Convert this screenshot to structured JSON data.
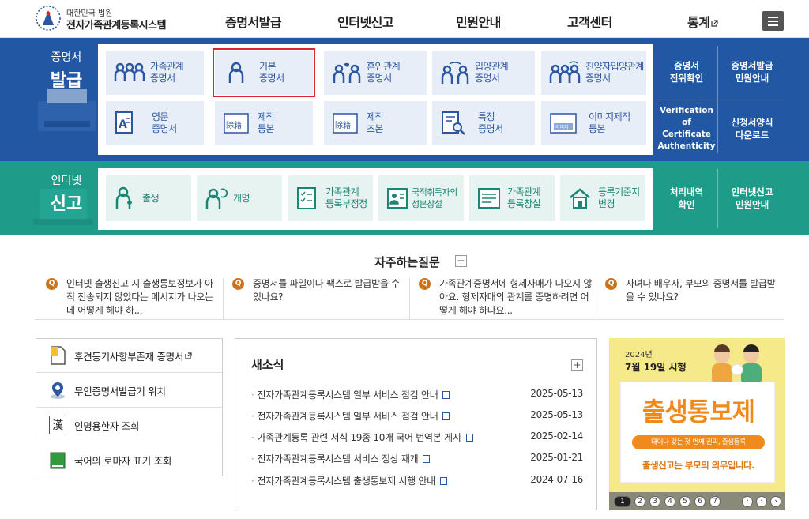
{
  "header": {
    "org": "대한민국 법원",
    "system": "전자가족관계등록시스템",
    "nav": [
      "증명서발급",
      "인터넷신고",
      "민원안내",
      "고객센터",
      "통계"
    ]
  },
  "cert": {
    "band_small": "증명서",
    "band_big": "발급",
    "cards": [
      {
        "l1": "가족관계",
        "l2": "증명서"
      },
      {
        "l1": "기본",
        "l2": "증명서"
      },
      {
        "l1": "혼인관계",
        "l2": "증명서"
      },
      {
        "l1": "입양관계",
        "l2": "증명서"
      },
      {
        "l1": "친양자입양관계",
        "l2": "증명서"
      },
      {
        "l1": "영문",
        "l2": "증명서"
      },
      {
        "l1": "제적",
        "l2": "등본"
      },
      {
        "l1": "제적",
        "l2": "초본"
      },
      {
        "l1": "특정",
        "l2": "증명서"
      },
      {
        "l1": "이미지제적",
        "l2": "등본"
      }
    ],
    "side": [
      {
        "l1": "증명서",
        "l2": "진위확인"
      },
      {
        "l1": "증명서발급",
        "l2": "민원안내"
      },
      {
        "l1": "Verification of",
        "l2": "Certificate",
        "l3": "Authenticity"
      },
      {
        "l1": "신청서양식",
        "l2": "다운로드"
      }
    ],
    "icon_texts": {
      "jejeok": "除籍",
      "image": "이미지"
    }
  },
  "report": {
    "band_small": "인터넷",
    "band_big": "신고",
    "cards": [
      {
        "l1": "출생",
        "l2": ""
      },
      {
        "l1": "개명",
        "l2": ""
      },
      {
        "l1": "가족관계",
        "l2": "등록부정정"
      },
      {
        "l1": "국적취득자의",
        "l2": "성본창설"
      },
      {
        "l1": "가족관계",
        "l2": "등록창설"
      },
      {
        "l1": "등록기준지",
        "l2": "변경"
      }
    ],
    "side": [
      {
        "l1": "처리내역",
        "l2": "확인"
      },
      {
        "l1": "인터넷신고",
        "l2": "민원안내"
      }
    ]
  },
  "faq": {
    "title": "자주하는질문",
    "q_mark": "Q",
    "plus": "+",
    "items": [
      "인터넷 출생신고 시 출생통보정보가 아직 전송되지 않았다는 메시지가 나오는데 어떻게 해야 하...",
      "증명서를 파일이나 팩스로 발급받을 수 있나요?",
      "가족관계증명서에 형제자매가 나오지 않아요. 형제자매의 관계를 증명하려면 어떻게 해야 하나요...",
      "자녀나 배우자, 부모의 증명서를 발급받을 수 있나요?"
    ]
  },
  "links": [
    "후견등기사항부존재 증명서",
    "무인증명서발급기 위치",
    "인명용한자 조회",
    "국어의 로마자 표기 조회"
  ],
  "han_icon": "漢",
  "news": {
    "title": "새소식",
    "plus": "+",
    "items": [
      {
        "title": "전자가족관계등록시스템 일부 서비스 점검 안내",
        "date": "2025-05-13"
      },
      {
        "title": "전자가족관계등록시스템 일부 서비스 점검 안내",
        "date": "2025-05-13"
      },
      {
        "title": "가족관계등록 관련 서식 19종 10개 국어 번역본 게시",
        "date": "2025-02-14"
      },
      {
        "title": "전자가족관계등록시스템 서비스 정상 재개",
        "date": "2025-01-21"
      },
      {
        "title": "전자가족관계등록시스템 출생통보제 시행 안내",
        "date": "2024-07-16"
      }
    ]
  },
  "banner": {
    "year": "2024년",
    "date": "7월 19일 시행",
    "title": "출생통보제",
    "pill": "태어나 갖는 첫 번째 권리, 출생등록",
    "foot": "출생신고는 부모의 의무입니다.",
    "pages": [
      "1",
      "2",
      "3",
      "4",
      "5",
      "6",
      "7"
    ],
    "controls": [
      "‹",
      "›",
      "›"
    ]
  },
  "colors": {
    "blue": "#2157a3",
    "teal": "#1f9b8a",
    "highlight": "#d9262c"
  }
}
